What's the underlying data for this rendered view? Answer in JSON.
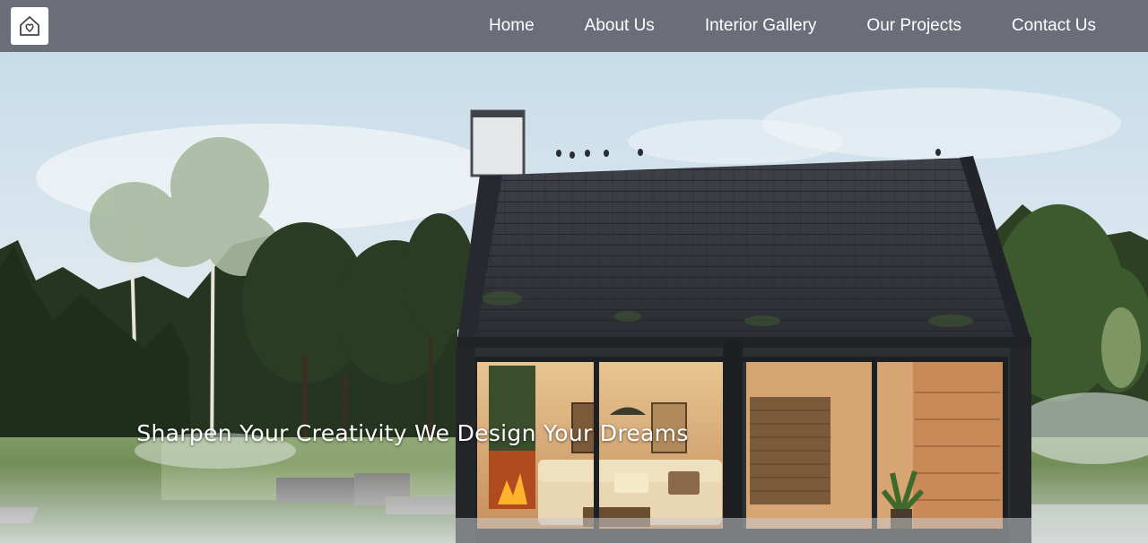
{
  "logo": {
    "icon": "house-heart-icon"
  },
  "nav": {
    "items": [
      {
        "label": "Home"
      },
      {
        "label": "About Us"
      },
      {
        "label": "Interior Gallery"
      },
      {
        "label": "Our Projects"
      },
      {
        "label": "Contact Us"
      }
    ]
  },
  "hero": {
    "tagline": "Sharpen Your Creativity We Design Your Dreams"
  },
  "colors": {
    "navbar": "#6b6e78",
    "nav_text": "#ffffff",
    "sky": "#cfe0ec"
  }
}
